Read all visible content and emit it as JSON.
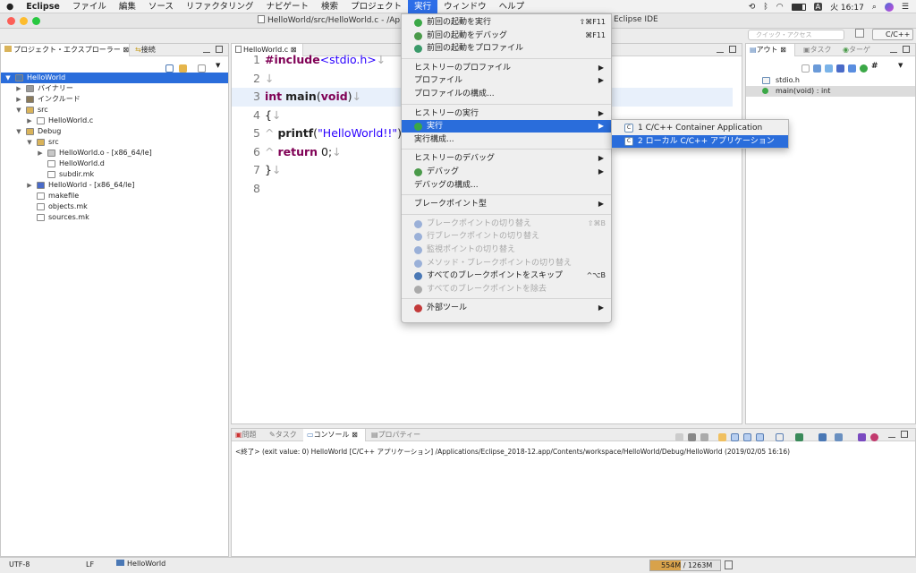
{
  "menubar": {
    "app": "Eclipse",
    "items": [
      "ファイル",
      "編集",
      "ソース",
      "リファクタリング",
      "ナビゲート",
      "検索",
      "プロジェクト",
      "実行",
      "ウィンドウ",
      "ヘルプ"
    ],
    "clock": "火 16:17",
    "input_badge": "A"
  },
  "window": {
    "title": "HelloWorld/src/HelloWorld.c - /Ap",
    "title_suffix": "Eclipse IDE"
  },
  "toolbar": {
    "quick_access": "クイック・アクセス",
    "perspective": "C/C++"
  },
  "left_view": {
    "tab_project_explorer": "プロジェクト・エクスプローラー",
    "tab_connections": "接続",
    "tree": [
      {
        "label": "HelloWorld",
        "depth": 0,
        "arrow": "▼",
        "selected": true,
        "icon": "project-icon"
      },
      {
        "label": "バイナリー",
        "depth": 1,
        "arrow": "▶",
        "icon": "binaries-icon"
      },
      {
        "label": "インクルード",
        "depth": 1,
        "arrow": "▶",
        "icon": "includes-icon"
      },
      {
        "label": "src",
        "depth": 1,
        "arrow": "▼",
        "icon": "folder-icon"
      },
      {
        "label": "HelloWorld.c",
        "depth": 2,
        "arrow": "▶",
        "icon": "c-file-icon"
      },
      {
        "label": "Debug",
        "depth": 1,
        "arrow": "▼",
        "icon": "folder-icon"
      },
      {
        "label": "src",
        "depth": 2,
        "arrow": "▼",
        "icon": "folder-icon"
      },
      {
        "label": "HelloWorld.o - [x86_64/le]",
        "depth": 3,
        "arrow": "▶",
        "icon": "object-file-icon"
      },
      {
        "label": "HelloWorld.d",
        "depth": 3,
        "arrow": "",
        "icon": "file-icon"
      },
      {
        "label": "subdir.mk",
        "depth": 3,
        "arrow": "",
        "icon": "file-icon"
      },
      {
        "label": "HelloWorld - [x86_64/le]",
        "depth": 2,
        "arrow": "▶",
        "icon": "executable-icon"
      },
      {
        "label": "makefile",
        "depth": 2,
        "arrow": "",
        "icon": "file-icon"
      },
      {
        "label": "objects.mk",
        "depth": 2,
        "arrow": "",
        "icon": "file-icon"
      },
      {
        "label": "sources.mk",
        "depth": 2,
        "arrow": "",
        "icon": "file-icon"
      }
    ]
  },
  "editor": {
    "tab": "HelloWorld.c",
    "lines": [
      {
        "n": "1",
        "parts": [
          [
            "kw",
            "#include"
          ],
          [
            "str",
            "<stdio.h>"
          ],
          [
            "ws",
            "↓"
          ]
        ]
      },
      {
        "n": "2",
        "parts": [
          [
            "ws",
            "↓"
          ]
        ]
      },
      {
        "n": "3",
        "parts": [
          [
            "kw",
            "int"
          ],
          [
            "t",
            " "
          ],
          [
            "b",
            "main"
          ],
          [
            "t",
            "("
          ],
          [
            "kw",
            "void"
          ],
          [
            "t",
            ")"
          ],
          [
            "ws",
            "↓"
          ]
        ],
        "hl": true
      },
      {
        "n": "4",
        "parts": [
          [
            "t",
            "{"
          ],
          [
            "ws",
            "↓"
          ]
        ]
      },
      {
        "n": "5",
        "parts": [
          [
            "ws",
            "^  "
          ],
          [
            "b",
            "printf"
          ],
          [
            "t",
            "("
          ],
          [
            "str",
            "\"HelloWorld!!\""
          ],
          [
            "t",
            ");"
          ]
        ]
      },
      {
        "n": "6",
        "parts": [
          [
            "ws",
            "^  "
          ],
          [
            "kw",
            "return"
          ],
          [
            "t",
            " 0;"
          ],
          [
            "ws",
            "↓"
          ]
        ]
      },
      {
        "n": "7",
        "parts": [
          [
            "t",
            "}"
          ],
          [
            "ws",
            "↓"
          ]
        ]
      },
      {
        "n": "8",
        "parts": []
      }
    ]
  },
  "outline": {
    "tab_outline": "アウト",
    "tab_task": "タスク",
    "tab_target": "ターゲ",
    "items": [
      "stdio.h",
      "main(void) : int"
    ]
  },
  "console": {
    "tab_problems": "問題",
    "tab_tasks": "タスク",
    "tab_console": "コンソール",
    "tab_properties": "プロパティー",
    "text": "<終了> (exit value: 0) HelloWorld [C/C++ アプリケーション] /Applications/Eclipse_2018-12.app/Contents/workspace/HelloWorld/Debug/HelloWorld (2019/02/05 16:16)"
  },
  "status": {
    "encoding": "UTF-8",
    "line_delim": "LF",
    "project": "HelloWorld",
    "heap": "554M / 1263M",
    "heap_used_fraction": 0.44
  },
  "run_menu": {
    "items": [
      {
        "label": "前回の起動を実行",
        "shortcut": "⇧⌘F11",
        "icon": "run-icon"
      },
      {
        "label": "前回の起動をデバッグ",
        "shortcut": "⌘F11",
        "icon": "debug-icon"
      },
      {
        "label": "前回の起動をプロファイル",
        "shortcut": "",
        "icon": "profile-icon"
      },
      {
        "sep": true
      },
      {
        "label": "ヒストリーのプロファイル",
        "sub": true
      },
      {
        "label": "プロファイル",
        "sub": true
      },
      {
        "label": "プロファイルの構成..."
      },
      {
        "sep": true
      },
      {
        "label": "ヒストリーの実行",
        "sub": true
      },
      {
        "label": "実行",
        "sub": true,
        "hi": true,
        "icon": "run-icon"
      },
      {
        "label": "実行構成..."
      },
      {
        "sep": true
      },
      {
        "label": "ヒストリーのデバッグ",
        "sub": true
      },
      {
        "label": "デバッグ",
        "sub": true,
        "icon": "debug-icon"
      },
      {
        "label": "デバッグの構成..."
      },
      {
        "sep": true
      },
      {
        "label": "ブレークポイント型",
        "sub": true
      },
      {
        "sep": true
      },
      {
        "label": "ブレークポイントの切り替え",
        "shortcut": "⇧⌘B",
        "dis": true,
        "icon": "breakpoint-icon"
      },
      {
        "label": "行ブレークポイントの切り替え",
        "dis": true,
        "icon": "breakpoint-icon"
      },
      {
        "label": "監視ポイントの切り替え",
        "dis": true,
        "icon": "breakpoint-icon"
      },
      {
        "label": "メソッド・ブレークポイントの切り替え",
        "dis": true,
        "icon": "breakpoint-icon"
      },
      {
        "label": "すべてのブレークポイントをスキップ",
        "shortcut": "^⌥B",
        "icon": "skip-breakpoints-icon"
      },
      {
        "label": "すべてのブレークポイントを除去",
        "dis": true,
        "icon": "remove-breakpoints-icon"
      },
      {
        "sep": true
      },
      {
        "label": "外部ツール",
        "sub": true,
        "icon": "external-tools-icon"
      }
    ]
  },
  "run_submenu": {
    "items": [
      {
        "label": "1 C/C++ Container Application"
      },
      {
        "label": "2 ローカル C/C++ アプリケーション",
        "hi": true
      }
    ]
  },
  "colors": {
    "accent": "#2a6ddb",
    "keyword": "#7f0055",
    "string": "#2a00ff"
  }
}
